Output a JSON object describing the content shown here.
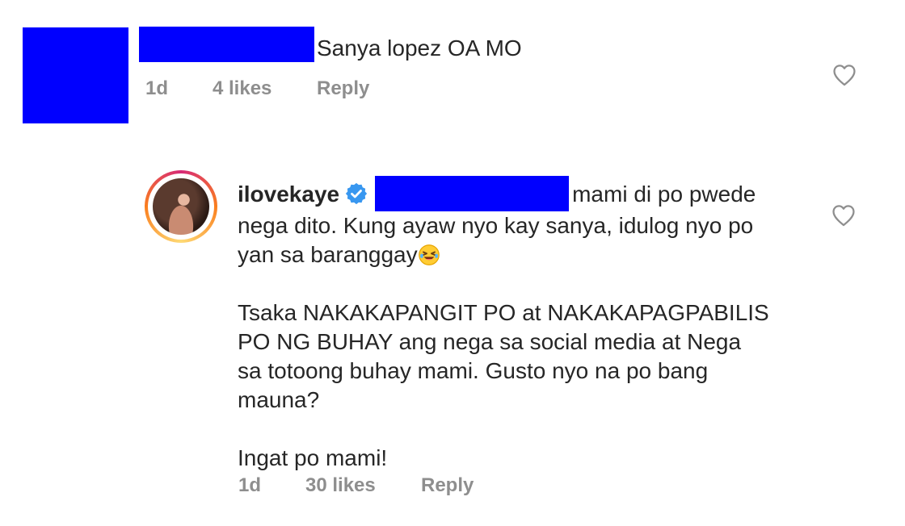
{
  "comment1": {
    "text": "Sanya lopez OA MO",
    "time": "1d",
    "likes": "4 likes",
    "reply_label": "Reply",
    "like_icon": "heart-outline-icon"
  },
  "comment2": {
    "username": "ilovekaye",
    "verified_icon": "verified-badge-icon",
    "line1": "mami di po pwede",
    "line2": "nega dito. Kung ayaw nyo kay sanya, idulog nyo po",
    "line3": "yan sa baranggay",
    "emoji_icon": "rolling-laughing-emoji",
    "para2_line1": "Tsaka NAKAKAPANGIT PO at NAKAKAPAGPABILIS",
    "para2_line2": "PO NG BUHAY ang nega sa social media at Nega",
    "para2_line3": "sa totoong buhay mami. Gusto nyo na po bang",
    "para2_line4": "mauna?",
    "para3": "Ingat po mami!",
    "time": "1d",
    "likes": "30 likes",
    "reply_label": "Reply",
    "like_icon": "heart-outline-icon"
  },
  "colors": {
    "redaction": "#0000ff",
    "meta_text": "#8e8e8e",
    "verified_blue": "#3897f0"
  }
}
